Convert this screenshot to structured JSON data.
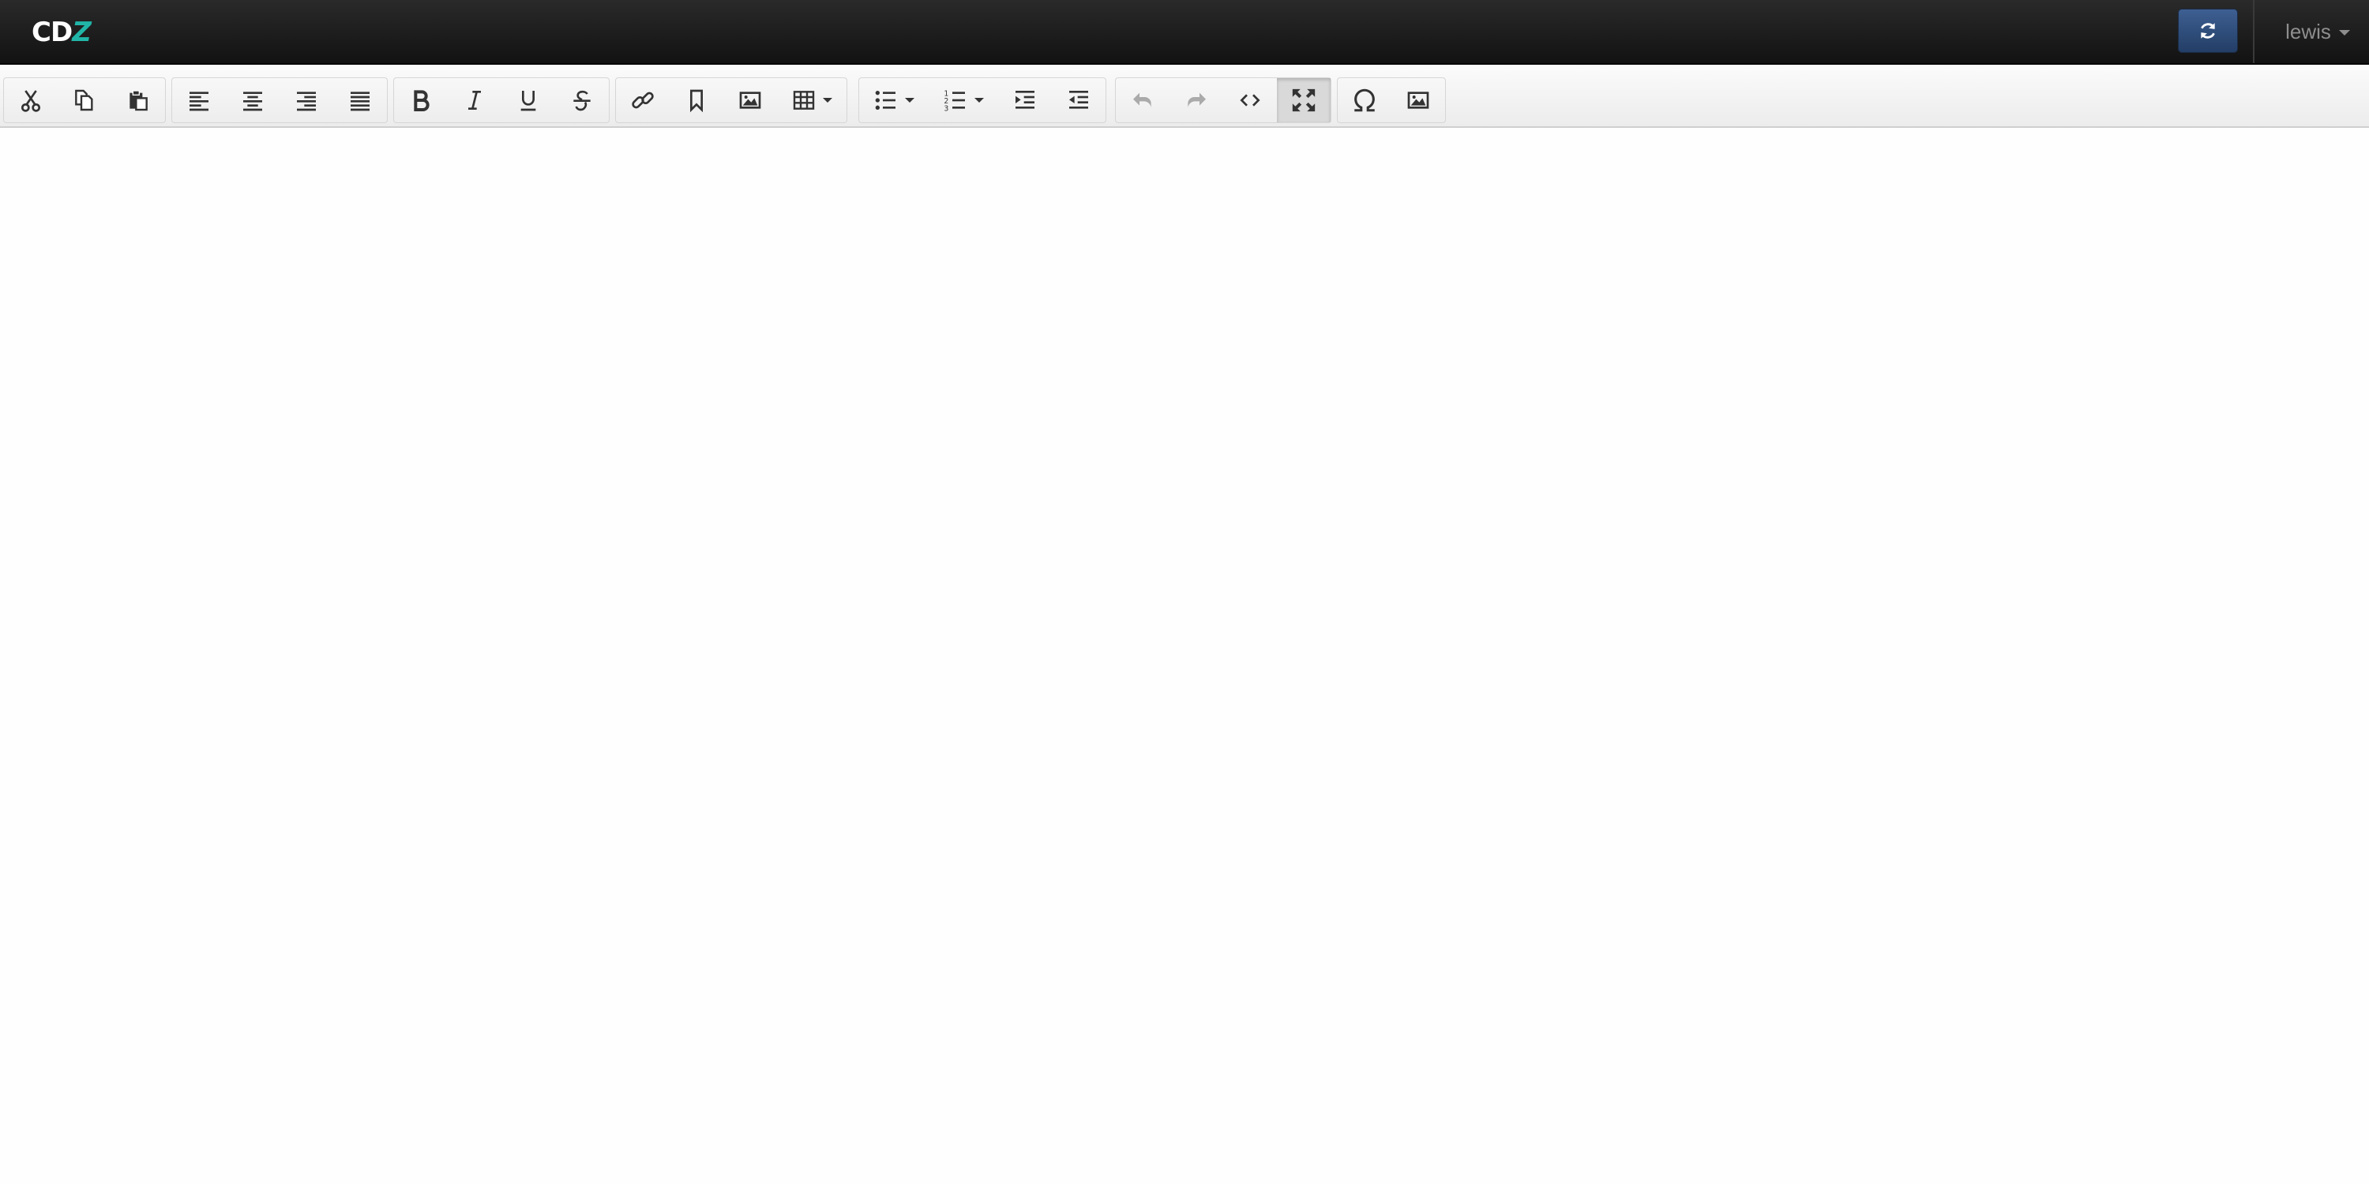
{
  "navbar": {
    "logo_main": "CD",
    "logo_accent": "Z",
    "user_name": "lewis"
  },
  "toolbar": {
    "groups": [
      [
        "cut",
        "copy",
        "paste"
      ],
      [
        "align-left",
        "align-center",
        "align-right",
        "align-justify"
      ],
      [
        "bold",
        "italic",
        "underline",
        "strikethrough"
      ],
      [
        "link",
        "bookmark",
        "image",
        "table"
      ],
      [
        "bullet-list",
        "numbered-list",
        "indent",
        "outdent"
      ],
      [
        "undo",
        "redo",
        "source-code",
        "fullscreen"
      ],
      [
        "special-character",
        "insert-image"
      ]
    ],
    "active": "fullscreen",
    "disabled": [
      "undo",
      "redo"
    ]
  },
  "colors": {
    "navbar_bg": "#1a1a1a",
    "accent": "#21b5a8",
    "refresh_button": "#2f4e7e",
    "icon": "#333333",
    "icon_disabled": "#aaaaaa"
  }
}
